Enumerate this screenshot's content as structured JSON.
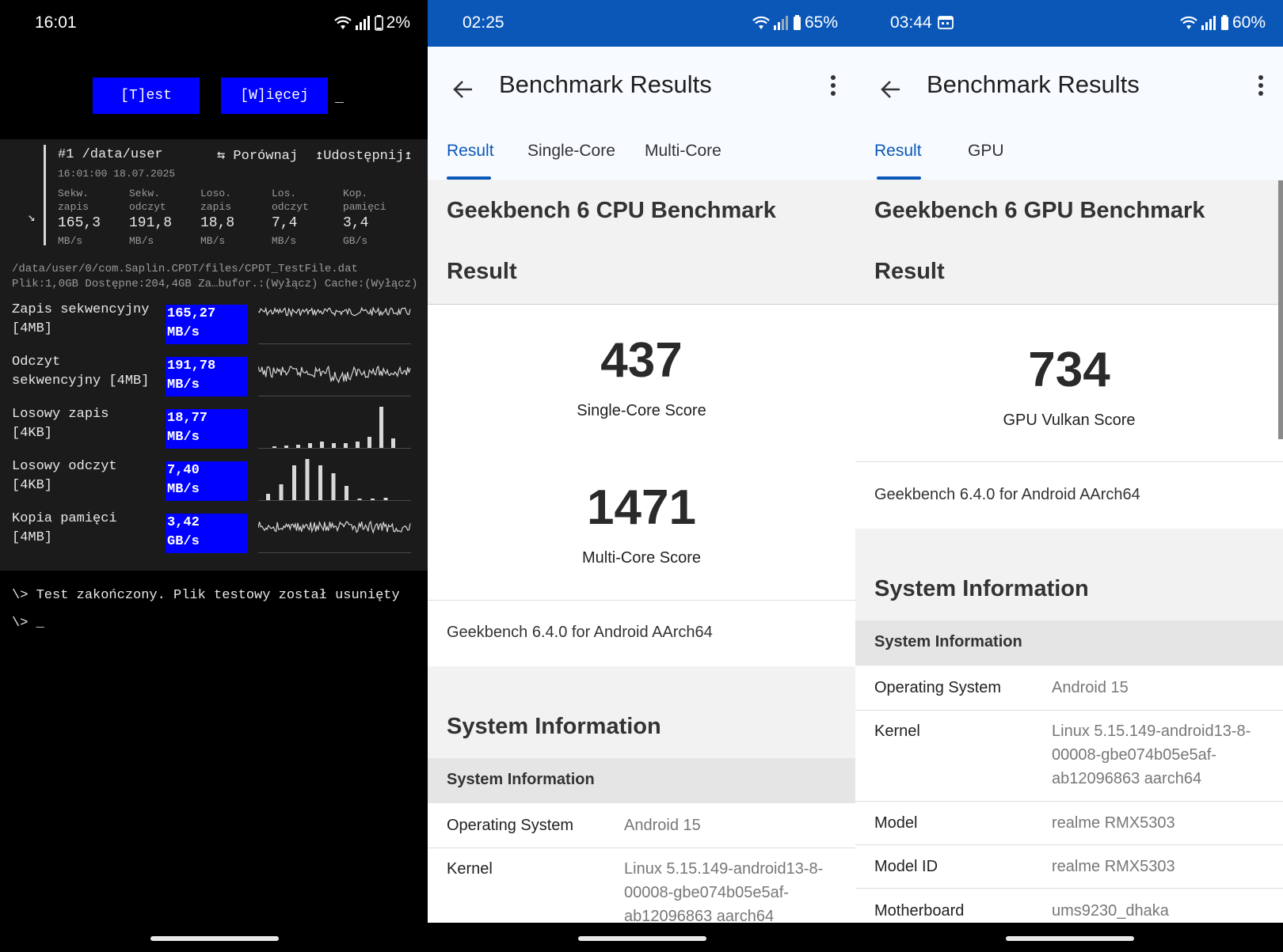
{
  "cpdt": {
    "status": {
      "time": "16:01",
      "battery": "2%"
    },
    "buttons": {
      "test": "[T]est",
      "more": "[W]ięcej"
    },
    "cursor": "_",
    "summary": {
      "arrow": "↘",
      "title": "#1 /data/user",
      "compare": "⇆ Porównaj",
      "share": "↥Udostępnij↥",
      "datetime": "16:01:00 18.07.2025",
      "metrics": [
        {
          "head1": "Sekw.",
          "head2": "zapis",
          "value": "165,3",
          "unit": "MB/s"
        },
        {
          "head1": "Sekw.",
          "head2": "odczyt",
          "value": "191,8",
          "unit": "MB/s"
        },
        {
          "head1": "Loso.",
          "head2": "zapis",
          "value": "18,8",
          "unit": "MB/s"
        },
        {
          "head1": "Los.",
          "head2": "odczyt",
          "value": "7,4",
          "unit": "MB/s"
        },
        {
          "head1": "Kop.",
          "head2": "pamięci",
          "value": "3,4",
          "unit": "GB/s"
        }
      ]
    },
    "path": "/data/user/0/com.Saplin.CPDT/files/CPDT_TestFile.dat",
    "file_info": "Plik:1,0GB Dostępne:204,4GB Za…bufor.:(Wyłącz) Cache:(Wyłącz)",
    "rows": [
      {
        "label1": "Zapis sekwencyjny",
        "label2": "[4MB]",
        "value": "165,27",
        "unit": "MB/s"
      },
      {
        "label1": "Odczyt",
        "label2": "sekwencyjny [4MB]",
        "value": "191,78",
        "unit": "MB/s"
      },
      {
        "label1": "Losowy zapis",
        "label2": "[4KB]",
        "value": "18,77",
        "unit": "MB/s"
      },
      {
        "label1": "Losowy odczyt",
        "label2": "[4KB]",
        "value": "7,40",
        "unit": "MB/s"
      },
      {
        "label1": "Kopia pamięci",
        "label2": "[4MB]",
        "value": "3,42",
        "unit": "GB/s"
      }
    ],
    "console": [
      "\\> Test zakończony. Plik testowy został usunięty",
      "\\> _"
    ]
  },
  "cpu": {
    "status": {
      "time": "02:25",
      "battery": "65%"
    },
    "title": "Benchmark Results",
    "tabs": [
      "Result",
      "Single-Core",
      "Multi-Core"
    ],
    "heading": "Geekbench 6 CPU Benchmark",
    "result_label": "Result",
    "single_score": "437",
    "single_label": "Single-Core Score",
    "multi_score": "1471",
    "multi_label": "Multi-Core Score",
    "version": "Geekbench 6.4.0 for Android AArch64",
    "sysinfo_title": "System Information",
    "sysinfo_sub": "System Information",
    "rows": [
      {
        "key": "Operating System",
        "value": "Android 15"
      },
      {
        "key": "Kernel",
        "value": "Linux 5.15.149-android13-8-00008-gbe074b05e5af-ab12096863 aarch64"
      }
    ]
  },
  "gpu": {
    "status": {
      "time": "03:44",
      "battery": "60%"
    },
    "title": "Benchmark Results",
    "tabs": [
      "Result",
      "GPU"
    ],
    "heading": "Geekbench 6 GPU Benchmark",
    "result_label": "Result",
    "score": "734",
    "score_label": "GPU Vulkan Score",
    "version": "Geekbench 6.4.0 for Android AArch64",
    "sysinfo_title": "System Information",
    "sysinfo_sub": "System Information",
    "rows": [
      {
        "key": "Operating System",
        "value": "Android 15"
      },
      {
        "key": "Kernel",
        "value": "Linux 5.15.149-android13-8-00008-gbe074b05e5af-ab12096863 aarch64"
      },
      {
        "key": "Model",
        "value": "realme RMX5303"
      },
      {
        "key": "Model ID",
        "value": "realme RMX5303"
      },
      {
        "key": "Motherboard",
        "value": "ums9230_dhaka"
      }
    ]
  },
  "colors": {
    "terminal_blue": "#0000ff",
    "accent": "#0a57b8",
    "terminal_bg": "#1b1b1b"
  },
  "icons": [
    "wifi-icon",
    "signal-icon",
    "battery-icon",
    "back-arrow-icon",
    "more-vert-icon",
    "calendar-icon",
    "arrow-down-right-icon"
  ]
}
